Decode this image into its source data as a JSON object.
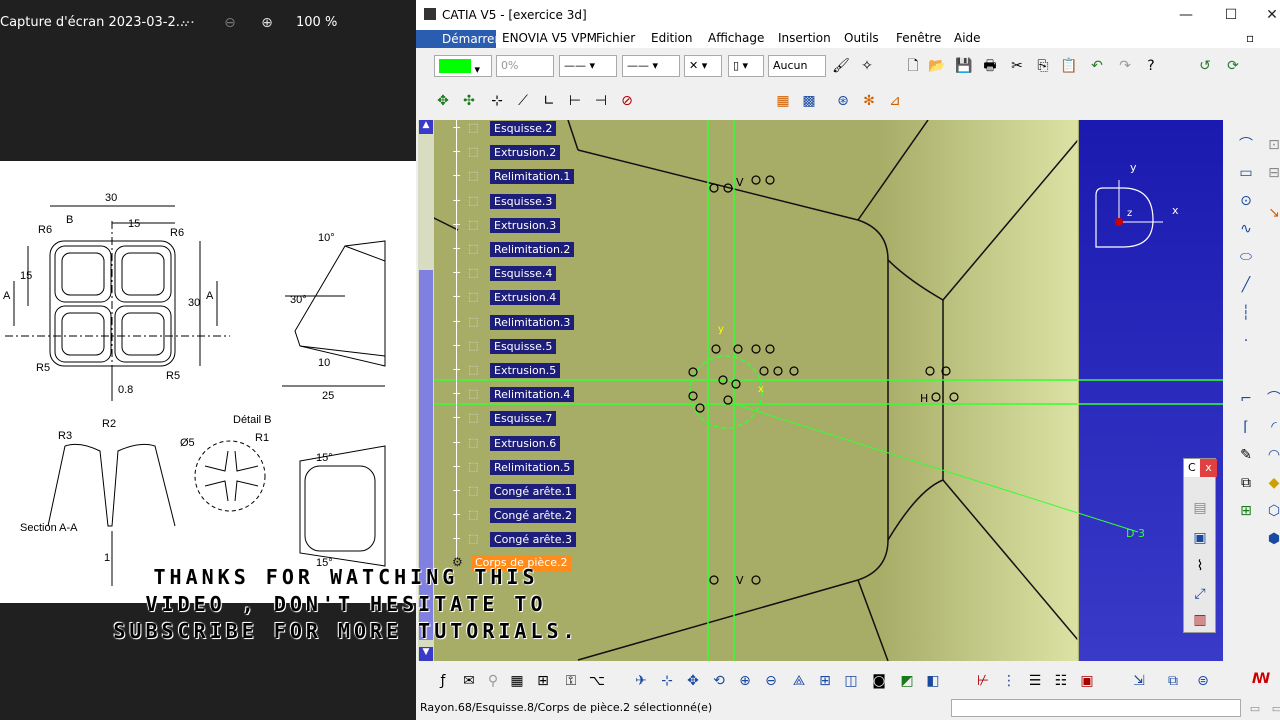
{
  "viewer": {
    "title": "Capture d'écran 2023-03-2...",
    "zoom": "100 %",
    "drawing_labels": {
      "dim_30_top": "30",
      "dim_15_top": "15",
      "r6_left": "R6",
      "r6_right": "R6",
      "b": "B",
      "dim_15_left": "15",
      "dim_30_right": "30",
      "a_left": "A",
      "a_right": "A",
      "r5_left": "R5",
      "r5_right": "R5",
      "dim_08": "0.8",
      "detail_b": "Détail B",
      "angle_10": "10°",
      "angle_30": "30°",
      "dim_10": "10",
      "dim_25": "25",
      "r3": "R3",
      "r2": "R2",
      "section_aa": "Section A-A",
      "dia5": "Ø5",
      "r1": "R1",
      "angle_15a": "15°",
      "angle_15b": "15°",
      "dim_1": "1"
    }
  },
  "catia": {
    "title": "CATIA V5 - [exercice 3d]",
    "menus": [
      "Démarrer",
      "ENOVIA V5 VPM",
      "Fichier",
      "Edition",
      "Affichage",
      "Insertion",
      "Outils",
      "Fenêtre",
      "Aide"
    ],
    "toolbar": {
      "color_value": "",
      "transparency_value": "0%",
      "layer_value": "Aucun"
    },
    "tree": [
      "Esquisse.2",
      "Extrusion.2",
      "Relimitation.1",
      "Esquisse.3",
      "Extrusion.3",
      "Relimitation.2",
      "Esquisse.4",
      "Extrusion.4",
      "Relimitation.3",
      "Esquisse.5",
      "Extrusion.5",
      "Relimitation.4",
      "Esquisse.7",
      "Extrusion.6",
      "Relimitation.5",
      "Congé arête.1",
      "Congé arête.2",
      "Congé arête.3"
    ],
    "tree_active": "Corps de pièce.2",
    "compass": {
      "x": "x",
      "y": "y",
      "z": "z"
    },
    "geometry_labels": {
      "constraint_v_top": "V",
      "constraint_v_bottom": "V",
      "constraint_h": "H",
      "dim_d3": "D 3",
      "axis_y": "y",
      "axis_x": "x"
    },
    "floating_panel_label": "C",
    "status": "Rayon.68/Esquisse.8/Corps de pièce.2 sélectionné(e)"
  },
  "caption": {
    "line1": "THANKS FOR WATCHING THIS",
    "line2": "VIDEO , DON'T HESITATE TO",
    "line3": "SUBSCRIBE FOR MORE TUTORIALS."
  },
  "colors": {
    "model": "#a7ad67",
    "background_blue": "#1a1ab0",
    "tree_node": "#1d1d7a",
    "sketch_green": "#33ff33",
    "start_menu": "#2a5db0"
  }
}
